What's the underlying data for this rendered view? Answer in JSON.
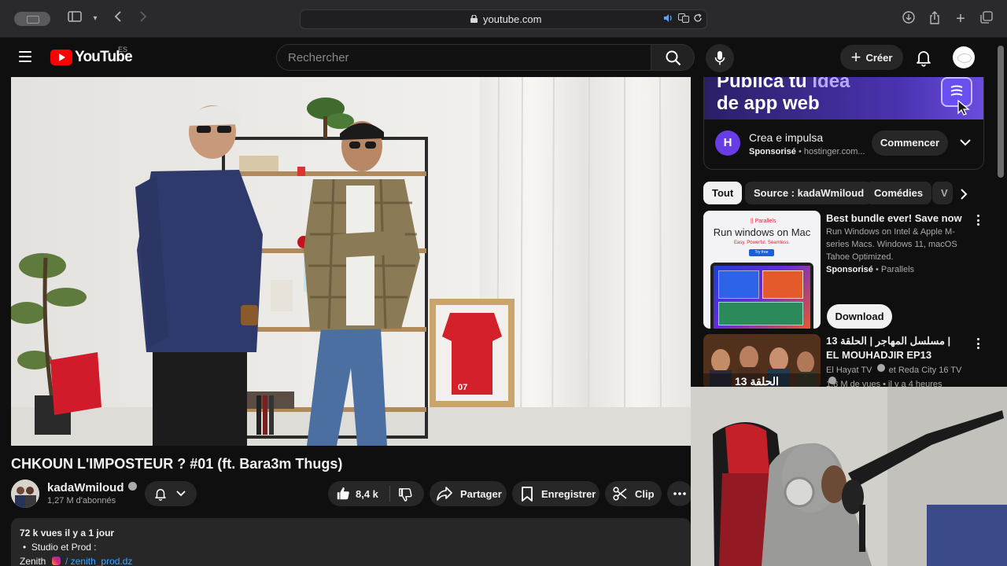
{
  "browser": {
    "url": "youtube.com"
  },
  "header": {
    "logo_text": "YouTube",
    "region": "ES",
    "search_placeholder": "Rechercher",
    "create_label": "Créer"
  },
  "video": {
    "title": "CHKOUN L'IMPOSTEUR ? #01 (ft. Bara3m Thugs)",
    "shirt_number": "07"
  },
  "channel": {
    "name": "kadaWmiloud",
    "subscribers": "1,27 M d'abonnés"
  },
  "actions": {
    "likes": "8,4 k",
    "share": "Partager",
    "save": "Enregistrer",
    "clip": "Clip"
  },
  "description": {
    "stats": "72 k vues  il y a 1 jour",
    "bullet": "Studio et Prod :",
    "line3_prefix": "Zenith",
    "line3_handle": "/ zenith_prod.dz"
  },
  "ad": {
    "banner_line1_a": "Publica tu ",
    "banner_line1_b": "idea",
    "banner_line2": "de app web",
    "title": "Crea e impulsa",
    "sponsored": "Sponsorisé",
    "domain": "• hostinger.com...",
    "cta": "Commencer"
  },
  "chips": [
    {
      "label": "Tout"
    },
    {
      "label": "Source : kadaWmiloud"
    },
    {
      "label": "Comédies"
    },
    {
      "label": "V"
    }
  ],
  "recommendations": [
    {
      "title": "Best bundle ever! Save now",
      "description": "Run Windows on Intel & Apple M-series Macs. Windows 11, macOS Tahoe Optimized.",
      "sponsored": "Sponsorisé",
      "advertiser": "• Parallels",
      "cta": "Download",
      "thumb_brand": "Parallels",
      "thumb_headline": "Run windows on Mac",
      "thumb_tagline": "Easy. Powerful. Seamless.",
      "thumb_button": "Try free"
    },
    {
      "title": "مسلسل المهاجر | الحلقة 13 | EL MOUHADJIR EP13",
      "channels": "El Hayat TV",
      "channels_and": "et Reda City 16 TV",
      "meta": "1,8 M de vues • il y a 4 heures",
      "thumb_caption": "الحلقة 13"
    }
  ],
  "colors": {
    "youtube_red": "#ff0000",
    "background": "#0f0f0f",
    "pill": "#272727",
    "hostinger_purple": "#673de6"
  }
}
